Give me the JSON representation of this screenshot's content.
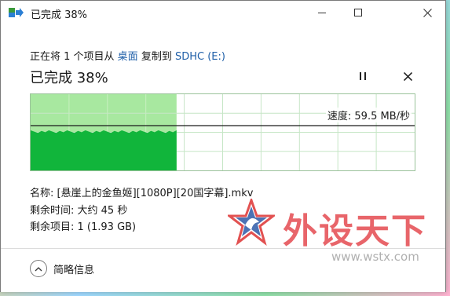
{
  "window": {
    "title": "已完成 38%",
    "controls": {
      "minimize": "minimize",
      "maximize": "maximize",
      "close": "close"
    }
  },
  "copy": {
    "prefix": "正在将 1 个项目从 ",
    "source": "桌面",
    "middle": " 复制到 ",
    "destination": "SDHC (E:)",
    "status_title": "已完成 38%",
    "progress": 0.38,
    "speed_text": "速度: 59.5 MB/秒"
  },
  "details": {
    "name_line": "名称: [悬崖上的金鱼姬][1080P][20国字幕].mkv",
    "time_line": "剩余时间: 大约 45 秒",
    "items_line": "剩余项目: 1 (1.93 GB)"
  },
  "footer": {
    "less_details": "简略信息"
  },
  "watermark": {
    "brand": "外设天下",
    "url": "www.wstx.com"
  },
  "colors": {
    "progress_fill": "#a8e8a0",
    "speed_area": "#11b53b",
    "link": "#1f5fa8",
    "watermark": "#e23a40"
  }
}
